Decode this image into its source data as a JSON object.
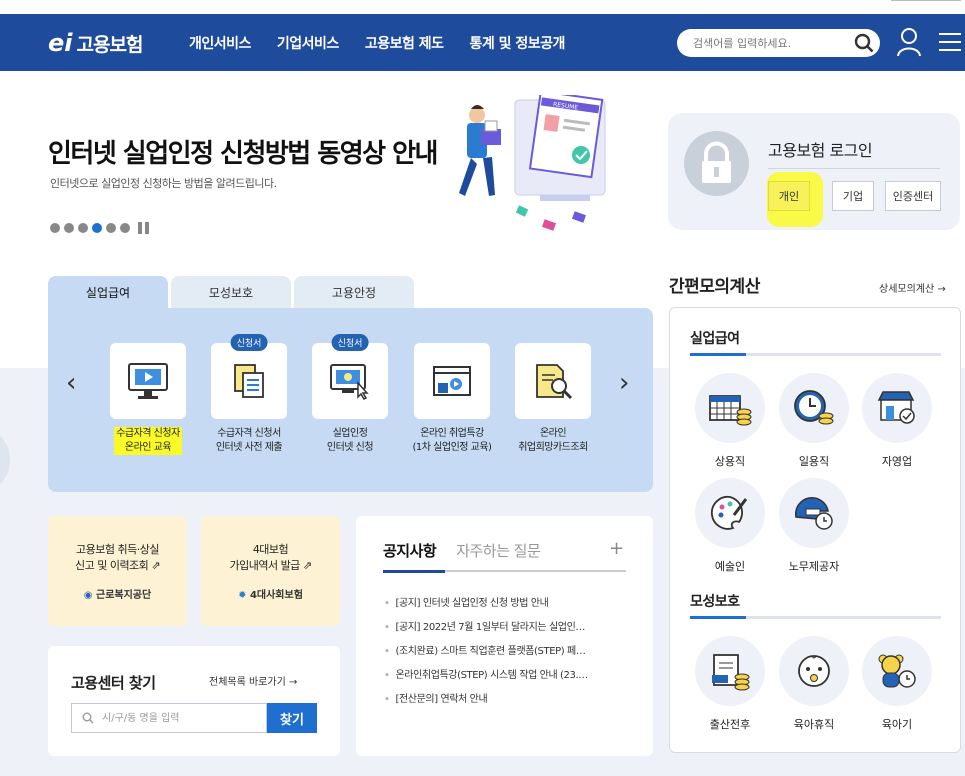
{
  "header": {
    "logo_mark": "ei",
    "logo_text": "고용보험",
    "nav": [
      "개인서비스",
      "기업서비스",
      "고용보험 제도",
      "통계 및 정보공개"
    ],
    "search_placeholder": "검색어를 입력하세요."
  },
  "hero": {
    "title": "인터넷 실업인정 신청방법 동영상 안내",
    "subtitle": "인터넷으로 실업인정 신청하는 방법을 알려드립니다.",
    "illus_label": "RESUME"
  },
  "login": {
    "title": "고용보험 로그인",
    "buttons": [
      "개인",
      "기업",
      "인증센터"
    ]
  },
  "service_tabs": [
    "실업급여",
    "모성보호",
    "고용안정"
  ],
  "services": [
    {
      "badge": "",
      "line1": "수급자격 신청자",
      "line2": "온라인 교육"
    },
    {
      "badge": "신청서",
      "line1": "수급자격 신청서",
      "line2": "인터넷 사전 제출"
    },
    {
      "badge": "신청서",
      "line1": "실업인정",
      "line2": "인터넷 신청"
    },
    {
      "badge": "",
      "line1": "온라인 취업특강",
      "line2": "(1차 실업인정 교육)"
    },
    {
      "badge": "",
      "line1": "온라인",
      "line2": "취업희망카드조회"
    }
  ],
  "cards": [
    {
      "line1": "고용보험 취득·상실",
      "line2": "신고 및 이력조회",
      "org": "근로복지공단"
    },
    {
      "line1": "4대보험",
      "line2": "가입내역서 발급",
      "org": "4대사회보험"
    }
  ],
  "notice": {
    "tabs": [
      "공지사항",
      "자주하는 질문"
    ],
    "items": [
      "[공지] 인터넷 실업인정 신청 방법 안내",
      "[공지] 2022년 7월 1일부터 달라지는 실업인…",
      "(조치완료) 스마트 직업훈련 플랫폼(STEP) 페…",
      "온라인취업특강(STEP) 시스템 작업 안내 (23.…",
      "[전산문의] 연락처 안내"
    ]
  },
  "center_finder": {
    "title": "고용센터 찾기",
    "more": "전체목록 바로가기",
    "placeholder": "시/구/동 명을 입력",
    "button": "찾기"
  },
  "calc": {
    "title": "간편모의계산",
    "more": "상세모의계산",
    "sections": [
      {
        "title": "실업급여",
        "items": [
          "상용직",
          "일용직",
          "자영업",
          "예술인",
          "노무제공자"
        ]
      },
      {
        "title": "모성보호",
        "items": [
          "출산전후",
          "육아휴직",
          "육아기"
        ]
      }
    ]
  },
  "colors": {
    "brand": "#1e4b9b",
    "accent": "#1e6fd0",
    "highlight": "#fafa29"
  }
}
